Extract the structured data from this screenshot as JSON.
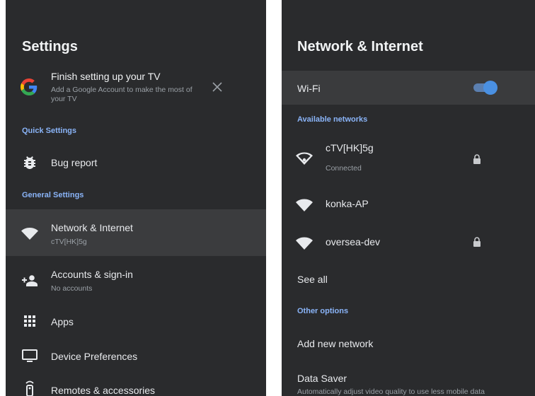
{
  "left_panel": {
    "title": "Settings",
    "setup_card": {
      "title": "Finish setting up your TV",
      "subtitle": "Add a Google Account to make the most of your TV"
    },
    "sections": {
      "quick": "Quick Settings",
      "general": "General Settings"
    },
    "items": [
      {
        "label": "Bug report",
        "icon": "bug-icon"
      },
      {
        "label": "Network & Internet",
        "sub": "cTV[HK]5g",
        "icon": "wifi-icon",
        "selected": true
      },
      {
        "label": "Accounts & sign-in",
        "sub": "No accounts",
        "icon": "add-person-icon"
      },
      {
        "label": "Apps",
        "icon": "apps-grid-icon"
      },
      {
        "label": "Device Preferences",
        "icon": "tv-icon"
      },
      {
        "label": "Remotes & accessories",
        "icon": "remote-icon"
      }
    ]
  },
  "right_panel": {
    "title": "Network & Internet",
    "wifi": {
      "label": "Wi-Fi",
      "enabled": true
    },
    "sections": {
      "available": "Available networks",
      "other": "Other options"
    },
    "networks": [
      {
        "name": "cTV[HK]5g",
        "status": "Connected",
        "secured": true
      },
      {
        "name": "konka-AP",
        "secured": false
      },
      {
        "name": "oversea-dev",
        "secured": true
      }
    ],
    "see_all": "See all",
    "add_network": "Add new network",
    "data_saver": {
      "title": "Data Saver",
      "subtitle": "Automatically adjust video quality to use less mobile data"
    }
  },
  "colors": {
    "panel_bg": "#2a2b2d",
    "section_accent": "#8ab4f8",
    "toggle_accent": "#4a90e2"
  }
}
